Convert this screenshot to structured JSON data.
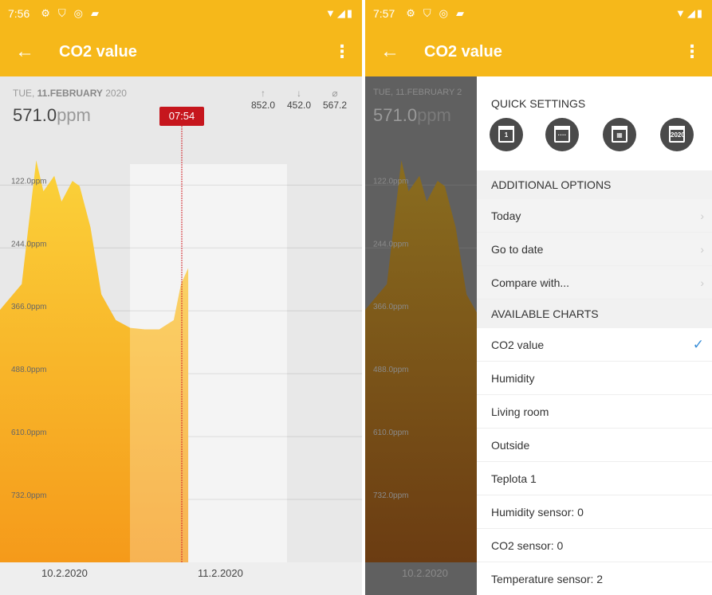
{
  "left": {
    "status": {
      "time": "7:56"
    },
    "appbar": {
      "title": "CO2 value"
    },
    "chart": {
      "day": "TUE, ",
      "date_bold": "11.FEBRUARY",
      "year": " 2020",
      "current_value": "571.0",
      "unit": "ppm",
      "stats": {
        "max_icon": "arrow-up-icon",
        "max": "852.0",
        "min_icon": "arrow-down-icon",
        "min": "452.0",
        "avg_icon": "average-icon",
        "avg": "567.2"
      },
      "cursor_time": "07:54",
      "y_ticks": [
        "732.0ppm",
        "610.0ppm",
        "488.0ppm",
        "366.0ppm",
        "244.0ppm",
        "122.0ppm"
      ],
      "x_ticks": [
        "10.2.2020",
        "11.2.2020"
      ]
    }
  },
  "right": {
    "status": {
      "time": "7:57"
    },
    "appbar": {
      "title": "CO2 value"
    },
    "bg": {
      "date": "TUE, 11.FEBRUARY 2",
      "value": "571.0",
      "unit": "ppm",
      "y_ticks": [
        "732.0ppm",
        "610.0ppm",
        "488.0ppm",
        "366.0ppm",
        "244.0ppm",
        "122.0ppm"
      ],
      "x_tick": "10.2.2020"
    },
    "drawer": {
      "quick_settings_title": "QUICK SETTINGS",
      "quick_icons": [
        {
          "name": "calendar-day-icon",
          "text": "1"
        },
        {
          "name": "calendar-week-icon",
          "text": "····"
        },
        {
          "name": "calendar-month-icon",
          "text": "▦"
        },
        {
          "name": "calendar-year-icon",
          "text": "2020"
        }
      ],
      "additional_title": "ADDITIONAL OPTIONS",
      "additional_items": [
        "Today",
        "Go to date",
        "Compare with..."
      ],
      "charts_title": "AVAILABLE CHARTS",
      "chart_items": [
        "CO2 value",
        "Humidity",
        "Living room",
        "Outside",
        "Teplota 1",
        "Humidity sensor: 0",
        "CO2 sensor: 0",
        "Temperature sensor: 2"
      ],
      "selected_index": 0
    }
  },
  "chart_data": {
    "type": "area",
    "x": [
      0,
      0.06,
      0.1,
      0.12,
      0.15,
      0.17,
      0.2,
      0.22,
      0.25,
      0.28,
      0.32,
      0.36,
      0.4,
      0.44,
      0.48,
      0.5,
      0.52
    ],
    "values": [
      490,
      540,
      780,
      720,
      750,
      700,
      740,
      730,
      650,
      520,
      470,
      455,
      452,
      452,
      470,
      540,
      571
    ],
    "ylim": [
      0,
      850
    ],
    "y_ticks": [
      122,
      244,
      366,
      488,
      610,
      732
    ],
    "x_labels": [
      "10.2.2020",
      "11.2.2020"
    ],
    "series_color": "#f6b81a"
  },
  "colors": {
    "accent": "#f6b81a",
    "badge": "#c6161d",
    "check": "#3a8fd8"
  }
}
